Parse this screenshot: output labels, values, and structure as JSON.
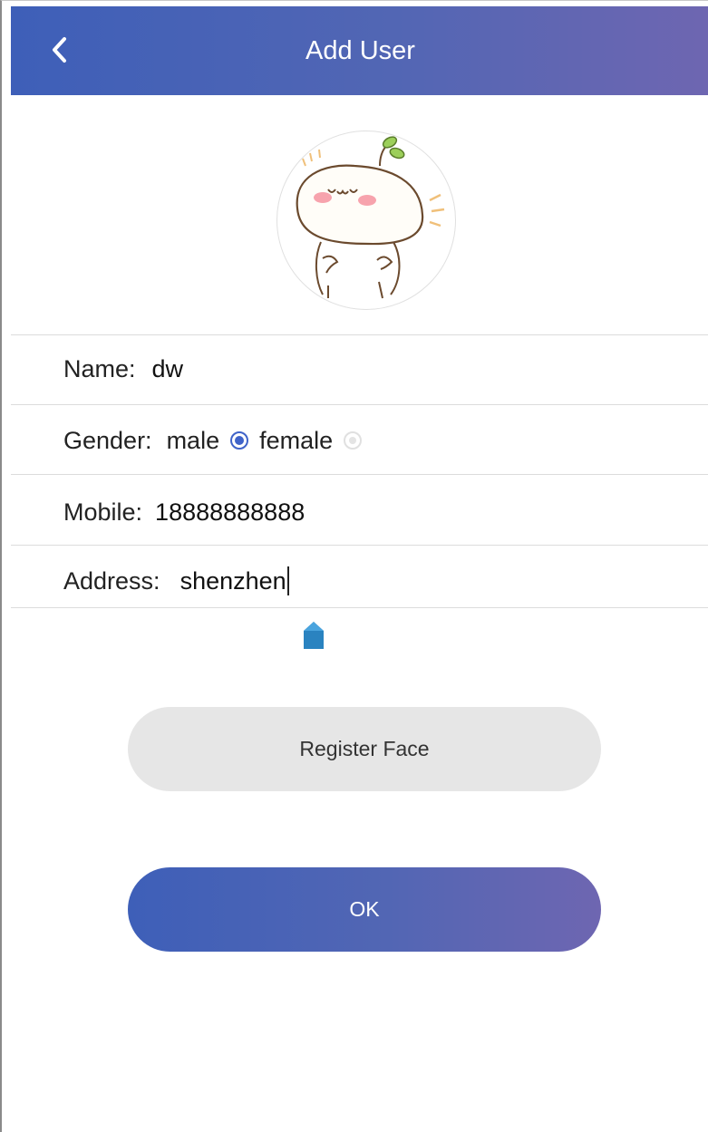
{
  "header": {
    "title": "Add User",
    "back_icon": "chevron-left-icon"
  },
  "avatar": {
    "description_icon": "cartoon-avatar"
  },
  "form": {
    "name": {
      "label": "Name:",
      "value": "dw"
    },
    "gender": {
      "label": "Gender:",
      "options": [
        {
          "label": "male",
          "selected": true
        },
        {
          "label": "female",
          "selected": false
        }
      ]
    },
    "mobile": {
      "label": "Mobile:",
      "value": "18888888888"
    },
    "address": {
      "label": "Address:",
      "value": "shenzhen"
    }
  },
  "buttons": {
    "register_face": "Register Face",
    "ok": "OK"
  },
  "colors": {
    "brand_start": "#3e5fb8",
    "brand_end": "#6e66b1",
    "radio_selected": "#3f63c9",
    "secondary_button": "#e6e6e6"
  }
}
